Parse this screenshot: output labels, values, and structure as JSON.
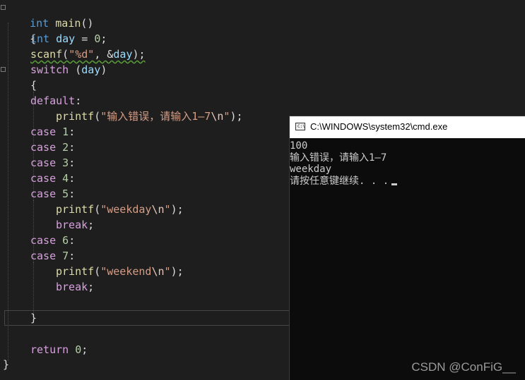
{
  "editor": {
    "lines": {
      "l1": {
        "kw": "int",
        "fn": "main",
        "rest": "()"
      },
      "l2": {
        "brace": "{"
      },
      "l3": {
        "kw": "int",
        "id": "day",
        "op": " = ",
        "num": "0",
        "end": ";"
      },
      "l4": {
        "fn": "scanf",
        "p1": "(",
        "str": "\"%d\"",
        "p2": ", &",
        "id": "day",
        "p3": ");"
      },
      "l5": {
        "kw": "switch",
        "p1": " (",
        "id": "day",
        "p2": ")"
      },
      "l6": {
        "brace": "{"
      },
      "l7": {
        "kw": "default",
        "colon": ":"
      },
      "l8": {
        "fn": "printf",
        "p1": "(",
        "str": "\"输入错误，请输入1—7",
        "esc": "\\n",
        "strend": "\"",
        "p2": ");"
      },
      "l9": {
        "kw": "case",
        "num": "1",
        "colon": ":"
      },
      "l10": {
        "kw": "case",
        "num": "2",
        "colon": ":"
      },
      "l11": {
        "kw": "case",
        "num": "3",
        "colon": ":"
      },
      "l12": {
        "kw": "case",
        "num": "4",
        "colon": ":"
      },
      "l13": {
        "kw": "case",
        "num": "5",
        "colon": ":"
      },
      "l14": {
        "fn": "printf",
        "p1": "(",
        "str": "\"weekday",
        "esc": "\\n",
        "strend": "\"",
        "p2": ");"
      },
      "l15": {
        "kw": "break",
        "end": ";"
      },
      "l16": {
        "kw": "case",
        "num": "6",
        "colon": ":"
      },
      "l17": {
        "kw": "case",
        "num": "7",
        "colon": ":"
      },
      "l18": {
        "fn": "printf",
        "p1": "(",
        "str": "\"weekend",
        "esc": "\\n",
        "strend": "\"",
        "p2": ");"
      },
      "l19": {
        "kw": "break",
        "end": ";"
      },
      "l20": {
        "brace": "}"
      },
      "l21": {
        "kw": "return",
        "num": "0",
        "end": ";"
      },
      "l22": {
        "brace": "}"
      }
    }
  },
  "console": {
    "title": "C:\\WINDOWS\\system32\\cmd.exe",
    "icon": "cmd-icon",
    "icon_text": "C:\\",
    "output": [
      "100",
      "输入错误，请输入1—7",
      "weekday",
      "请按任意键继续. . ."
    ]
  },
  "watermark": "CSDN @ConFiG__",
  "colors": {
    "background": "#1e1e1e",
    "keyword": "#569cd6",
    "control_keyword": "#d8a0df",
    "identifier": "#9cdcfe",
    "function": "#dcdcaa",
    "number": "#b5cea8",
    "string": "#d69d85",
    "console_bg": "#0c0c0c",
    "console_text": "#cccccc"
  }
}
